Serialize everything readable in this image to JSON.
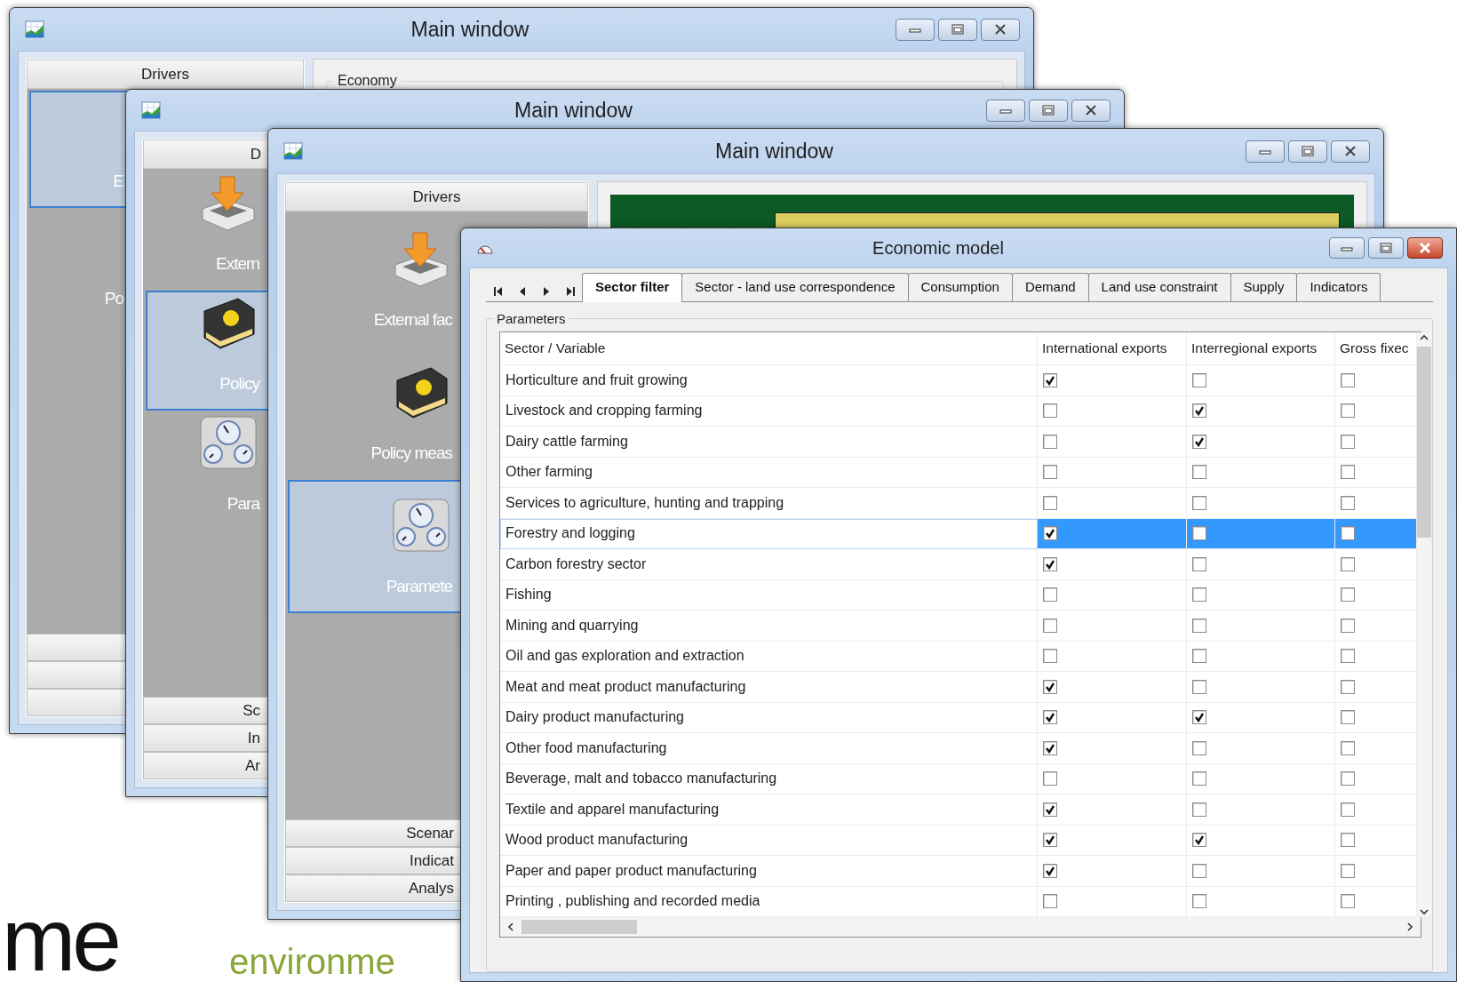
{
  "windows": [
    {
      "title": "Main window",
      "sidebar": {
        "header": "Drivers",
        "items": [
          {
            "label": "E",
            "selected": true
          },
          {
            "label": "Po",
            "selected": false
          }
        ]
      },
      "main": {
        "kind": "group",
        "group_label": "Economy"
      }
    },
    {
      "title": "Main window",
      "sidebar": {
        "header": "D",
        "items": [
          {
            "label": "Extern",
            "kind": "tray",
            "selected": false
          },
          {
            "label": "Policy",
            "kind": "book",
            "selected": true
          },
          {
            "label": "Para",
            "kind": "gauges",
            "selected": false
          }
        ],
        "bottom_buttons": [
          "Sc",
          "In",
          "Ar"
        ]
      }
    },
    {
      "title": "Main window",
      "sidebar": {
        "header": "Drivers",
        "items": [
          {
            "label": "External fac",
            "kind": "tray",
            "selected": false
          },
          {
            "label": "Policy meas",
            "kind": "book",
            "selected": false
          },
          {
            "label": "Paramete",
            "kind": "gauges",
            "selected": true
          }
        ],
        "bottom_buttons": [
          "Scenar",
          "Indicat",
          "Analys"
        ]
      },
      "main": {
        "kind": "preview"
      }
    }
  ],
  "dialog": {
    "title": "Economic model",
    "tabs": [
      {
        "label": "Sector filter",
        "selected": true
      },
      {
        "label": "Sector - land use correspondence",
        "selected": false
      },
      {
        "label": "Consumption",
        "selected": false
      },
      {
        "label": "Demand",
        "selected": false
      },
      {
        "label": "Land use constraint",
        "selected": false
      },
      {
        "label": "Supply",
        "selected": false
      },
      {
        "label": "Indicators",
        "selected": false
      }
    ],
    "group_label": "Parameters",
    "table": {
      "columns": [
        "Sector / Variable",
        "International exports",
        "Interregional exports",
        "Gross fixec"
      ],
      "rows": [
        {
          "sector": "Horticulture and fruit growing",
          "checks": [
            true,
            false,
            false
          ],
          "selected": false
        },
        {
          "sector": "Livestock and cropping farming",
          "checks": [
            false,
            true,
            false
          ],
          "selected": false
        },
        {
          "sector": "Dairy cattle farming",
          "checks": [
            false,
            true,
            false
          ],
          "selected": false
        },
        {
          "sector": "Other farming",
          "checks": [
            false,
            false,
            false
          ],
          "selected": false
        },
        {
          "sector": "Services to agriculture, hunting and trapping",
          "checks": [
            false,
            false,
            false
          ],
          "selected": false
        },
        {
          "sector": "Forestry and logging",
          "checks": [
            true,
            false,
            false
          ],
          "selected": true
        },
        {
          "sector": "Carbon forestry sector",
          "checks": [
            true,
            false,
            false
          ],
          "selected": false
        },
        {
          "sector": "Fishing",
          "checks": [
            false,
            false,
            false
          ],
          "selected": false
        },
        {
          "sector": "Mining and quarrying",
          "checks": [
            false,
            false,
            false
          ],
          "selected": false
        },
        {
          "sector": "Oil and gas exploration and extraction",
          "checks": [
            false,
            false,
            false
          ],
          "selected": false
        },
        {
          "sector": "Meat and meat product manufacturing",
          "checks": [
            true,
            false,
            false
          ],
          "selected": false
        },
        {
          "sector": "Dairy product manufacturing",
          "checks": [
            true,
            true,
            false
          ],
          "selected": false
        },
        {
          "sector": "Other food manufacturing",
          "checks": [
            true,
            false,
            false
          ],
          "selected": false
        },
        {
          "sector": "Beverage, malt and tobacco manufacturing",
          "checks": [
            false,
            false,
            false
          ],
          "selected": false
        },
        {
          "sector": "Textile and apparel manufacturing",
          "checks": [
            true,
            false,
            false
          ],
          "selected": false
        },
        {
          "sector": "Wood product manufacturing",
          "checks": [
            true,
            true,
            false
          ],
          "selected": false
        },
        {
          "sector": "Paper and paper product manufacturing",
          "checks": [
            true,
            false,
            false
          ],
          "selected": false
        },
        {
          "sector": "Printing , publishing and recorded media",
          "checks": [
            false,
            false,
            false
          ],
          "selected": false
        }
      ]
    }
  },
  "logo": {
    "wordmark": "me",
    "tagline": "environme"
  }
}
